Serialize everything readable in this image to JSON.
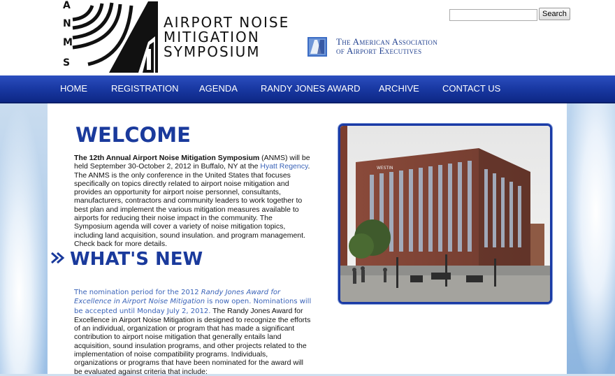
{
  "header": {
    "logo_letters": "ANMS",
    "logo_lines": [
      "AIRPORT NOISE",
      "MITIGATION",
      "SYMPOSIUM"
    ],
    "partner_lines": [
      "The American Association",
      "of Airport Executives"
    ]
  },
  "search": {
    "value": "",
    "placeholder": "",
    "button_label": "Search"
  },
  "nav": {
    "items": [
      "HOME",
      "REGISTRATION",
      "AGENDA",
      "RANDY JONES AWARD",
      "ARCHIVE",
      "CONTACT US"
    ]
  },
  "main": {
    "welcome_heading": "WELCOME",
    "intro_bold": "The 12th Annual Airport Noise Mitigation Symposium",
    "intro_part1": " (ANMS) will be held September 30-October 2, 2012 in Buffalo, NY at the ",
    "intro_link": "Hyatt Regency",
    "intro_part2": ". The ANMS is the only conference in the United States that focuses specifically on topics directly related to airport noise mitigation and provides an opportunity for airport noise personnel, consultants, manufacturers, contractors and community leaders to work together to best plan and implement the various mitigation measures available to airports for reducing their noise impact in the community. The Symposium agenda will cover a variety of noise mitigation topics, including land acquisition, sound insulation. and program management. Check back for more details.",
    "whatsnew_heading": "WHAT'S NEW",
    "news_blue_1": "The nomination period for the 2012 ",
    "news_blue_italic": "Randy Jones Award for Excellence in Airport Noise Mitigation",
    "news_blue_2": " is now open. Nominations will be accepted until Monday July 2, 2012.",
    "news_body": " The Randy Jones Award for Excellence in Airport Noise Mitigation is designed to recognize the efforts of an individual, organization or program that has made a significant contribution to airport noise mitigation that generally entails land acquisition, sound insulation programs, and other projects related to the implementation of noise compatibility programs. Individuals, organizations or programs that have been nominated for the award will be evaluated against criteria that include:",
    "photo_sign": "WESTIN"
  }
}
